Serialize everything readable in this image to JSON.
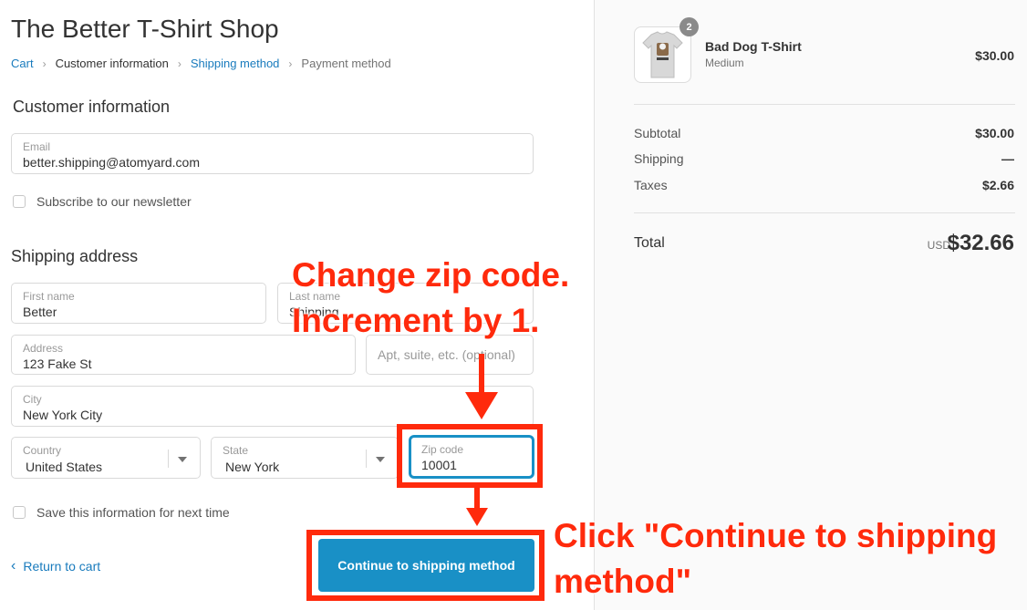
{
  "shop": {
    "title": "The Better T-Shirt Shop"
  },
  "breadcrumb": {
    "cart": "Cart",
    "customer_information": "Customer information",
    "shipping_method": "Shipping method",
    "payment_method": "Payment method",
    "separator": "›"
  },
  "customer": {
    "section_title": "Customer information",
    "email_label": "Email",
    "email_value": "better.shipping@atomyard.com",
    "newsletter_label": "Subscribe to our newsletter"
  },
  "shipping": {
    "section_title": "Shipping address",
    "first_name_label": "First name",
    "first_name_value": "Better",
    "last_name_label": "Last name",
    "last_name_value": "Shipping",
    "address_label": "Address",
    "address_value": "123 Fake St",
    "apt_placeholder": "Apt, suite, etc. (optional)",
    "city_label": "City",
    "city_value": "New York City",
    "country_label": "Country",
    "country_value": "United States",
    "state_label": "State",
    "state_value": "New York",
    "zip_label": "Zip code",
    "zip_value": "10001",
    "save_info_label": "Save this information for next time"
  },
  "actions": {
    "return_label": "Return to cart",
    "return_chevron": "‹",
    "continue_label": "Continue to shipping method"
  },
  "annotations": {
    "zip_line1": "Change zip code.",
    "zip_line2": "Increment by 1.",
    "click_line1": "Click \"Continue to shipping",
    "click_line2": "method\"",
    "color": "#ff2a0c"
  },
  "order": {
    "item": {
      "name": "Bad Dog T-Shirt",
      "variant": "Medium",
      "price": "$30.00",
      "quantity": "2"
    },
    "subtotal_label": "Subtotal",
    "subtotal_value": "$30.00",
    "shipping_label": "Shipping",
    "shipping_value": "—",
    "taxes_label": "Taxes",
    "taxes_value": "$2.66",
    "total_label": "Total",
    "total_currency": "USD",
    "total_value": "$32.66"
  },
  "colors": {
    "accent": "#1990c6",
    "link": "#197bbd",
    "annotation": "#ff2a0c"
  }
}
